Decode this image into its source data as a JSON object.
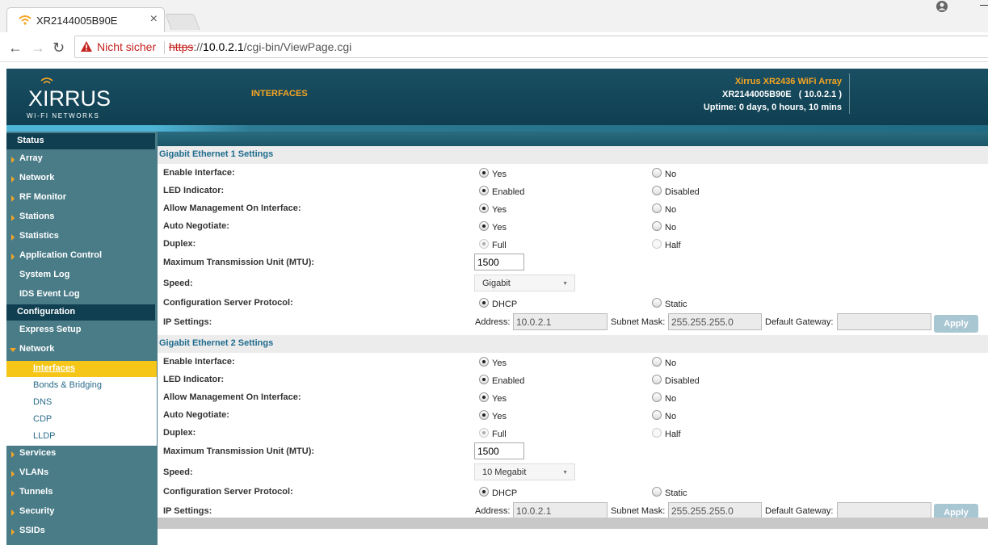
{
  "browser": {
    "tab_title": "XR2144005B90E",
    "tab_close": "×",
    "not_secure": "Nicht sicher",
    "url_scheme": "https",
    "url_sep": "://",
    "url_host": "10.0.2.1",
    "url_path": "/cgi-bin/ViewPage.cgi"
  },
  "header": {
    "logo_text": "XIRRUS",
    "logo_sub": "WI-FI NETWORKS",
    "page_heading": "INTERFACES",
    "model": "Xirrus XR2436 WiFi Array",
    "device": "XR2144005B90E   ( 10.0.2.1 )",
    "uptime": "Uptime:  0 days, 0 hours, 10 mins"
  },
  "sidebar": {
    "status_section": "Status",
    "status_items": [
      "Array",
      "Network",
      "RF Monitor",
      "Stations",
      "Statistics",
      "Application Control",
      "System Log",
      "IDS Event Log"
    ],
    "config_section": "Configuration",
    "express_setup": "Express Setup",
    "network": "Network",
    "network_sub": [
      "Interfaces",
      "Bonds & Bridging",
      "DNS",
      "CDP",
      "LLDP"
    ],
    "more_items": [
      "Services",
      "VLANs",
      "Tunnels",
      "Security",
      "SSIDs"
    ]
  },
  "eth1": {
    "title": "Gigabit Ethernet 1 Settings",
    "rows": {
      "enable": {
        "label": "Enable Interface:",
        "opt1": "Yes",
        "opt2": "No"
      },
      "led": {
        "label": "LED Indicator:",
        "opt1": "Enabled",
        "opt2": "Disabled"
      },
      "mgmt": {
        "label": "Allow Management On Interface:",
        "opt1": "Yes",
        "opt2": "No"
      },
      "autoneg": {
        "label": "Auto Negotiate:",
        "opt1": "Yes",
        "opt2": "No"
      },
      "duplex": {
        "label": "Duplex:",
        "opt1": "Full",
        "opt2": "Half"
      },
      "mtu": {
        "label": "Maximum Transmission Unit (MTU):",
        "value": "1500"
      },
      "speed": {
        "label": "Speed:",
        "value": "Gigabit"
      },
      "protocol": {
        "label": "Configuration Server Protocol:",
        "opt1": "DHCP",
        "opt2": "Static"
      },
      "ip": {
        "label": "IP Settings:",
        "address_label": "Address:",
        "address": "10.0.2.1",
        "mask_label": "Subnet Mask:",
        "mask": "255.255.255.0",
        "gw_label": "Default Gateway:",
        "gateway": "",
        "apply": "Apply"
      }
    }
  },
  "eth2": {
    "title": "Gigabit Ethernet 2 Settings",
    "rows": {
      "enable": {
        "label": "Enable Interface:",
        "opt1": "Yes",
        "opt2": "No"
      },
      "led": {
        "label": "LED Indicator:",
        "opt1": "Enabled",
        "opt2": "Disabled"
      },
      "mgmt": {
        "label": "Allow Management On Interface:",
        "opt1": "Yes",
        "opt2": "No"
      },
      "autoneg": {
        "label": "Auto Negotiate:",
        "opt1": "Yes",
        "opt2": "No"
      },
      "duplex": {
        "label": "Duplex:",
        "opt1": "Full",
        "opt2": "Half"
      },
      "mtu": {
        "label": "Maximum Transmission Unit (MTU):",
        "value": "1500"
      },
      "speed": {
        "label": "Speed:",
        "value": "10 Megabit"
      },
      "protocol": {
        "label": "Configuration Server Protocol:",
        "opt1": "DHCP",
        "opt2": "Static"
      },
      "ip": {
        "label": "IP Settings:",
        "address_label": "Address:",
        "address": "10.0.2.1",
        "mask_label": "Subnet Mask:",
        "mask": "255.255.255.0",
        "gw_label": "Default Gateway:",
        "gateway": "",
        "apply": "Apply"
      }
    }
  },
  "colors": {
    "accent": "#f5a623",
    "header_bg": "#0f3f51",
    "sidebar_bg": "#4a7c88",
    "active_item": "#f5c518",
    "section_text": "#1e6b8c"
  }
}
